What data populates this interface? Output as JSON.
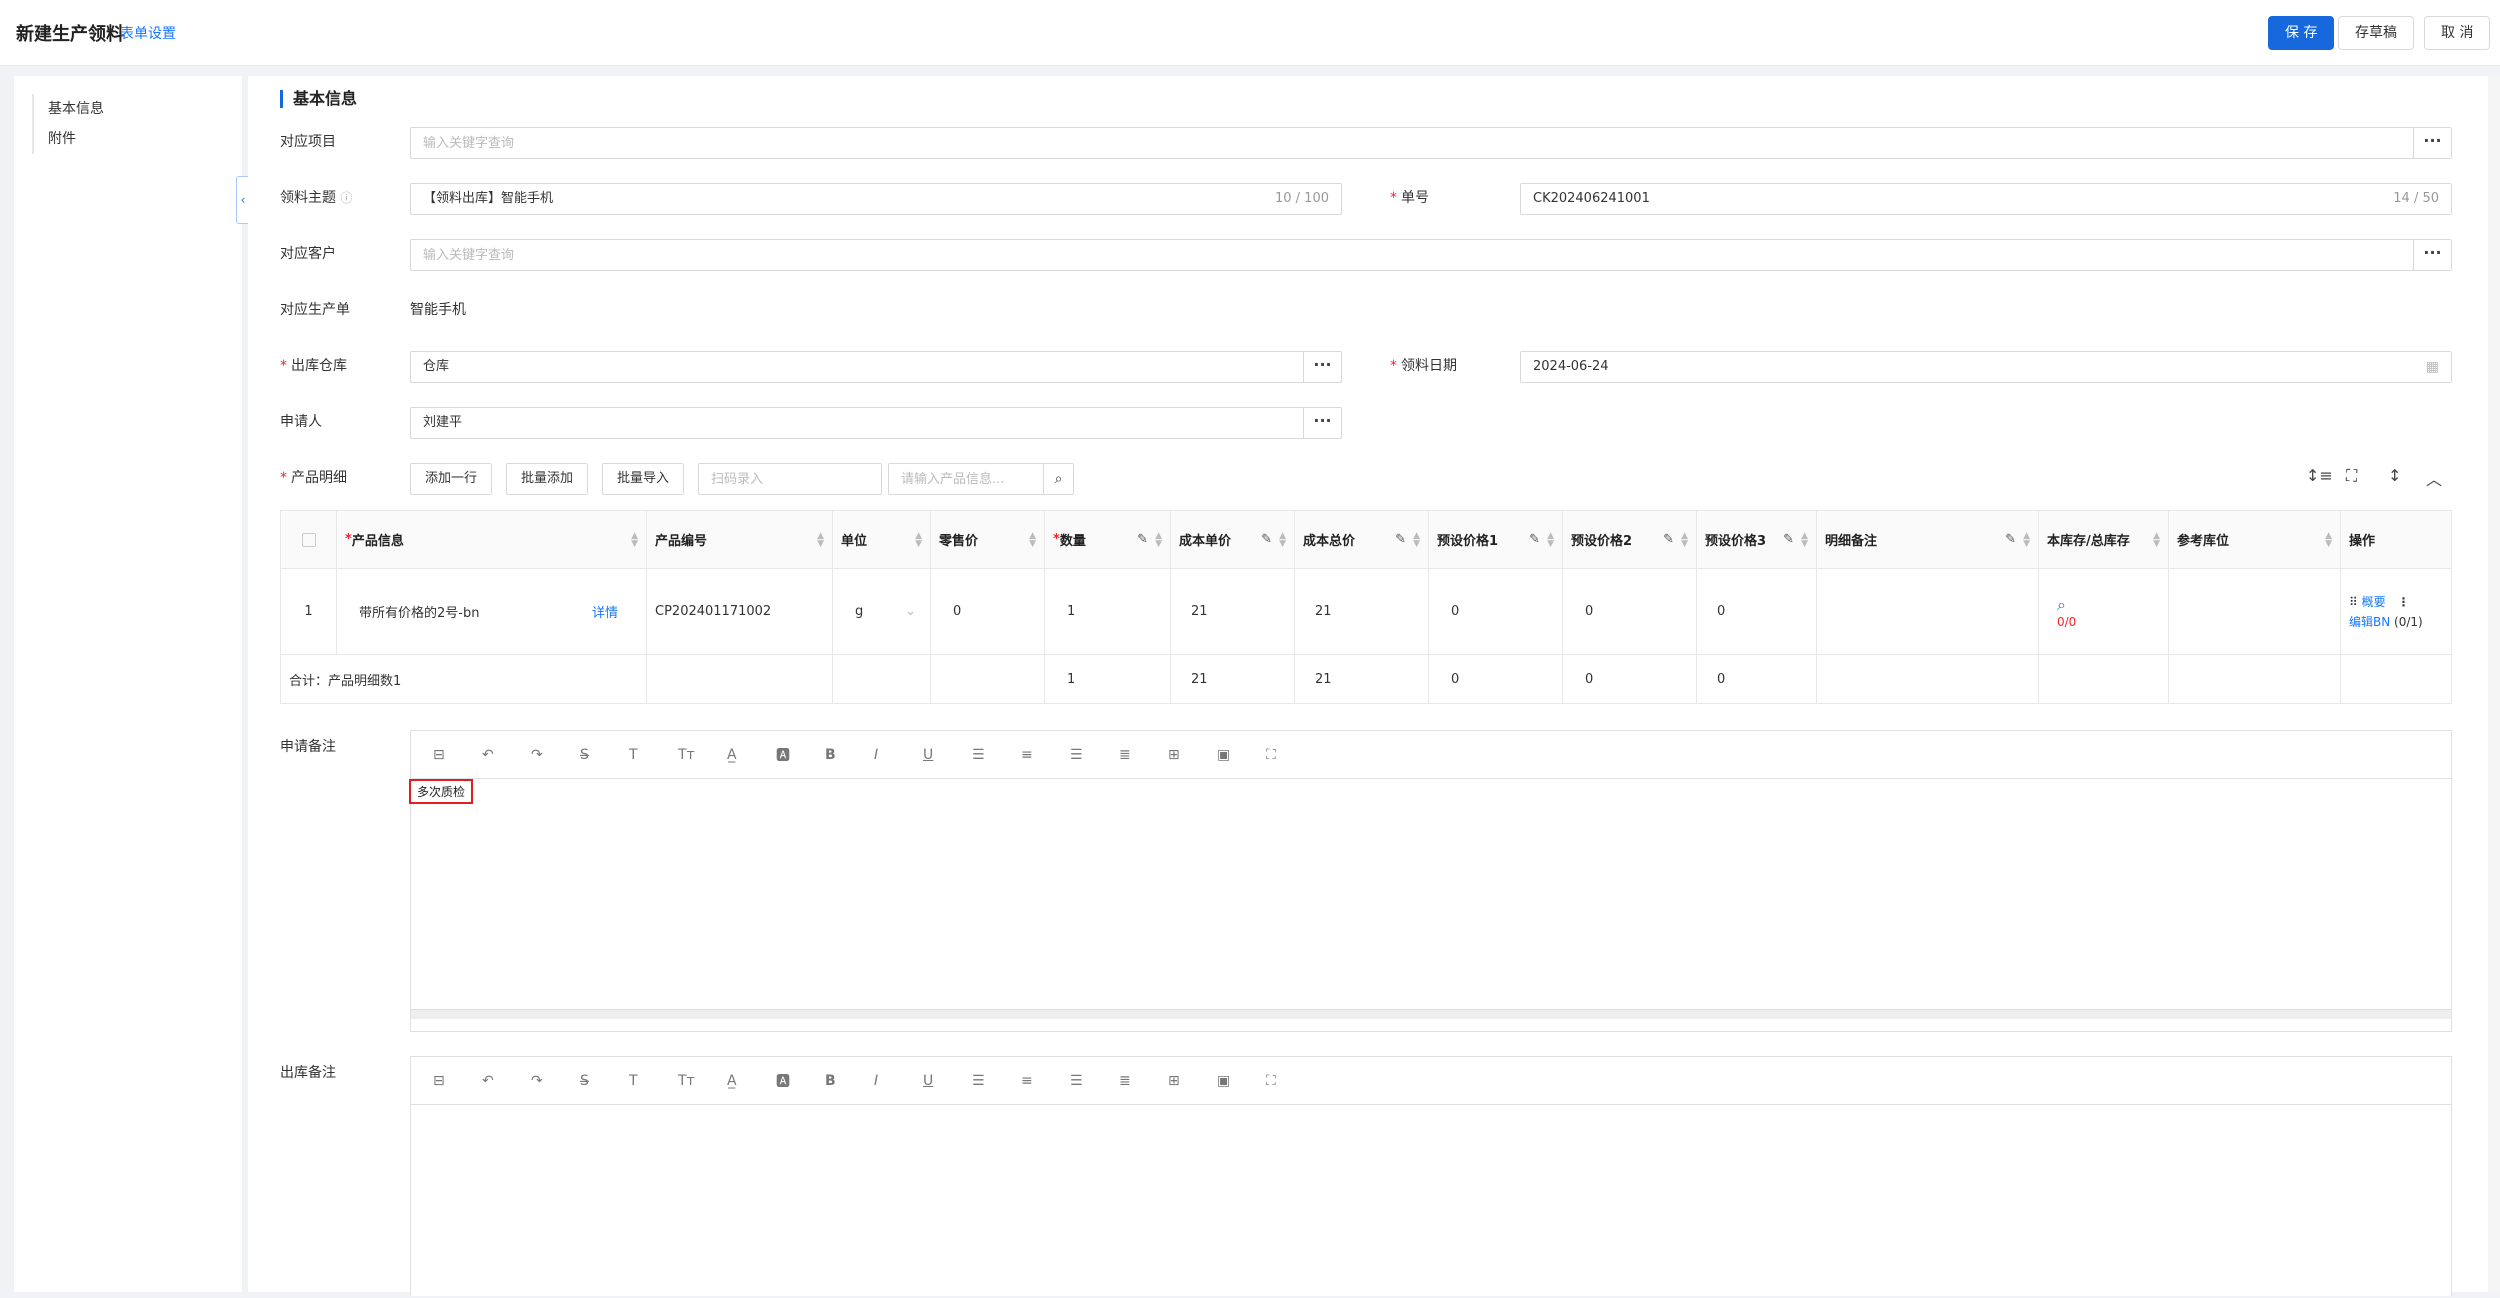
{
  "header": {
    "title": "新建生产领料",
    "settings_link": "表单设置",
    "save": "保 存",
    "draft": "存草稿",
    "cancel": "取 消"
  },
  "sidebar": {
    "items": [
      {
        "label": "基本信息"
      },
      {
        "label": "附件"
      }
    ],
    "collapse_icon": "‹"
  },
  "form": {
    "section_title": "基本信息",
    "project": {
      "label": "对应项目",
      "placeholder": "输入关键字查询"
    },
    "subject": {
      "label": "领料主题",
      "value": "【领料出库】智能手机",
      "count": "10 / 100"
    },
    "order_no": {
      "label": "单号",
      "value": "CK202406241001",
      "count": "14 / 50"
    },
    "customer": {
      "label": "对应客户",
      "placeholder": "输入关键字查询"
    },
    "production": {
      "label": "对应生产单",
      "value": "智能手机"
    },
    "warehouse": {
      "label": "出库仓库",
      "value": "仓库"
    },
    "date": {
      "label": "领料日期",
      "value": "2024-06-24"
    },
    "applicant": {
      "label": "申请人",
      "value": "刘建平"
    },
    "products": {
      "label": "产品明细",
      "add_row": "添加一行",
      "batch_add": "批量添加",
      "batch_import": "批量导入",
      "scan_placeholder": "扫码录入",
      "search_placeholder": "请输入产品信息..."
    },
    "more_glyph": "···"
  },
  "table": {
    "headers": [
      "产品信息",
      "产品编号",
      "单位",
      "零售价",
      "数量",
      "成本单价",
      "成本总价",
      "预设价格1",
      "预设价格2",
      "预设价格3",
      "明细备注",
      "本库存/总库存",
      "参考库位",
      "操作"
    ],
    "row": {
      "index": "1",
      "product": "带所有价格的2号-bn",
      "detail": "详情",
      "code": "CP202401171002",
      "unit": "g",
      "retail": "0",
      "qty": "1",
      "cost_unit": "21",
      "cost_total": "21",
      "p1": "0",
      "p2": "0",
      "p3": "0",
      "stock": "0/0",
      "ops_summary": "概要",
      "ops_edit": "编辑BN",
      "ops_count": "(0/1)"
    },
    "footer": {
      "summary": "合计：产品明细数1",
      "qty": "1",
      "cost_unit": "21",
      "cost_total": "21",
      "p1": "0",
      "p2": "0",
      "p3": "0"
    }
  },
  "remarks": {
    "apply_label": "申请备注",
    "apply_content": "多次质检",
    "out_label": "出库备注"
  }
}
